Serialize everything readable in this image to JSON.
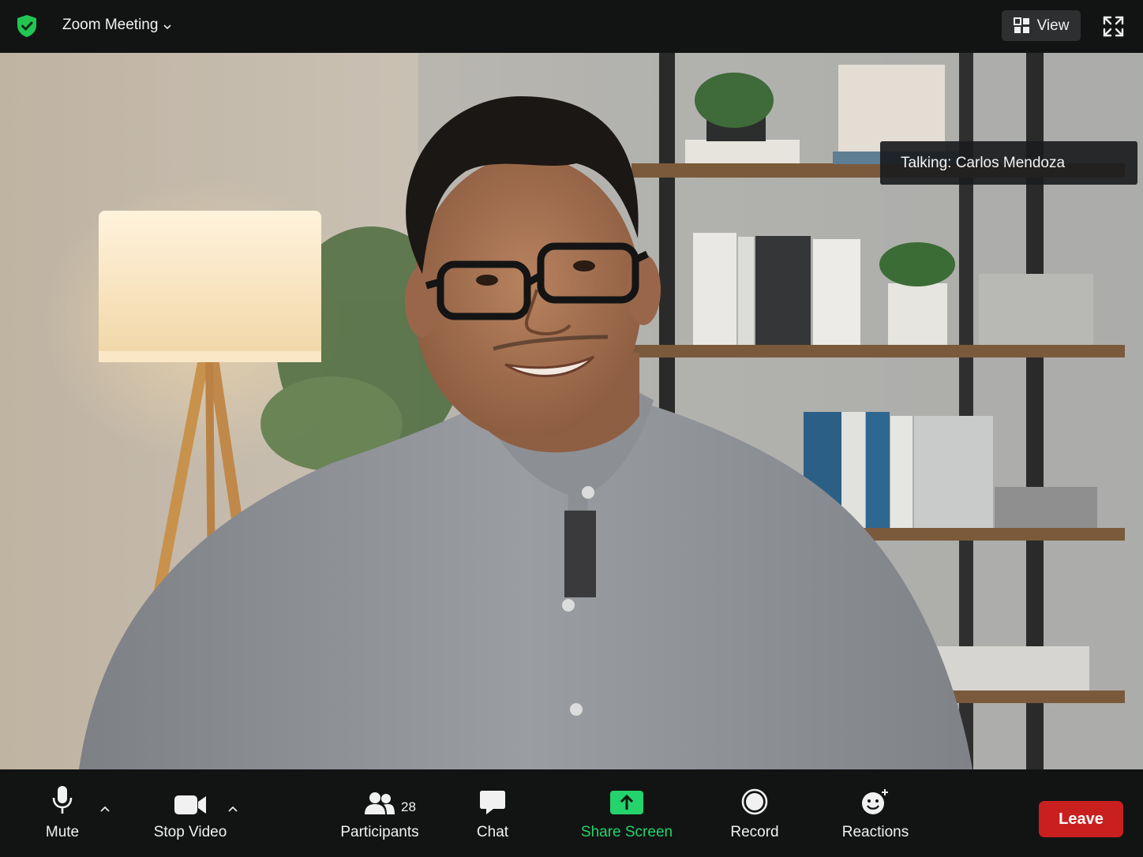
{
  "header": {
    "title": "Zoom Meeting",
    "view_label": "View"
  },
  "video": {
    "talking_label": "Talking: Carlos Mendoza"
  },
  "toolbar": {
    "mute_label": "Mute",
    "stop_video_label": "Stop Video",
    "participants_label": "Participants",
    "participants_count": "28",
    "chat_label": "Chat",
    "share_screen_label": "Share Screen",
    "record_label": "Record",
    "reactions_label": "Reactions",
    "leave_label": "Leave"
  },
  "colors": {
    "bar_bg": "#121414",
    "shield_green": "#23c552",
    "share_green": "#24d36b",
    "leave_red": "#c9201f"
  },
  "icons": [
    "shield-check-icon",
    "chevron-down-icon",
    "grid-view-icon",
    "fullscreen-icon",
    "microphone-icon",
    "caret-up-icon",
    "video-camera-icon",
    "participants-icon",
    "chat-bubble-icon",
    "share-screen-icon",
    "record-icon",
    "reactions-icon"
  ]
}
